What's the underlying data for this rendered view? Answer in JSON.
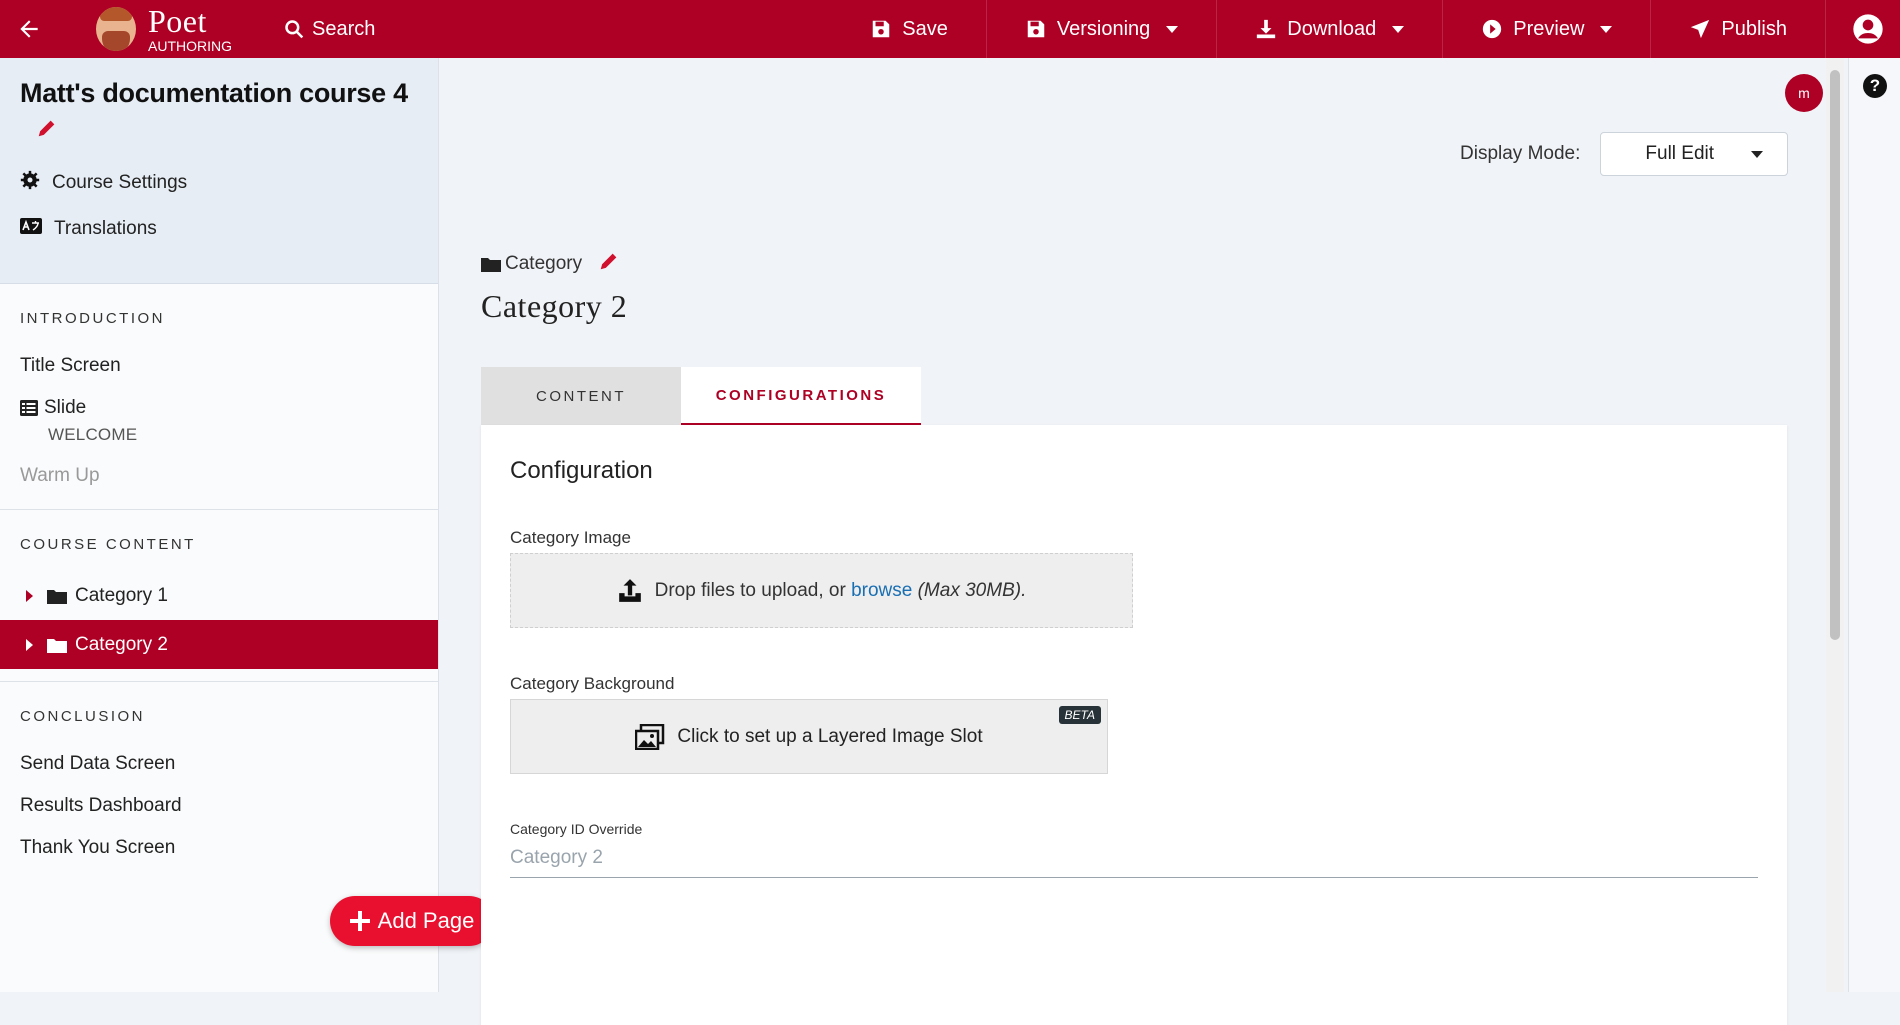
{
  "app": {
    "name": "Poet",
    "subtitle": "AUTHORING",
    "search_label": "Search"
  },
  "toolbar": {
    "save_label": "Save",
    "versioning_label": "Versioning",
    "download_label": "Download",
    "preview_label": "Preview",
    "publish_label": "Publish"
  },
  "sidebar": {
    "course_title": "Matt's documentation course 4",
    "links": [
      {
        "label": "Course Settings",
        "icon": "gear-icon"
      },
      {
        "label": "Translations",
        "icon": "translate-icon"
      }
    ],
    "sections": [
      {
        "title": "INTRODUCTION",
        "items": [
          {
            "label": "Title Screen"
          },
          {
            "label": "Slide",
            "sub": "WELCOME"
          },
          {
            "label": "Warm Up"
          }
        ]
      },
      {
        "title": "COURSE CONTENT",
        "items": [
          {
            "label": "Category 1"
          },
          {
            "label": "Category 2"
          }
        ]
      },
      {
        "title": "CONCLUSION",
        "items": [
          {
            "label": "Send Data Screen"
          },
          {
            "label": "Results Dashboard"
          },
          {
            "label": "Thank You Screen"
          }
        ]
      }
    ],
    "add_page_label": "Add Page"
  },
  "main": {
    "user_initial": "m",
    "display_mode_label": "Display Mode:",
    "display_mode_value": "Full Edit",
    "breadcrumb_label": "Category",
    "page_title": "Category 2",
    "tabs": [
      {
        "label": "CONTENT"
      },
      {
        "label": "CONFIGURATIONS"
      }
    ],
    "panel": {
      "title": "Configuration",
      "category_image_label": "Category Image",
      "drop_text": "Drop files to upload, or",
      "drop_link": "browse",
      "drop_hint": "(Max 30MB).",
      "category_background_label": "Category Background",
      "layered_text": "Click to set up a Layered Image Slot",
      "beta_label": "BETA",
      "id_override_label": "Category ID Override",
      "id_override_placeholder": "Category 2"
    }
  },
  "colors": {
    "brand": "#ad0024",
    "add_page": "#e8102e",
    "link": "#1a6fb3"
  }
}
